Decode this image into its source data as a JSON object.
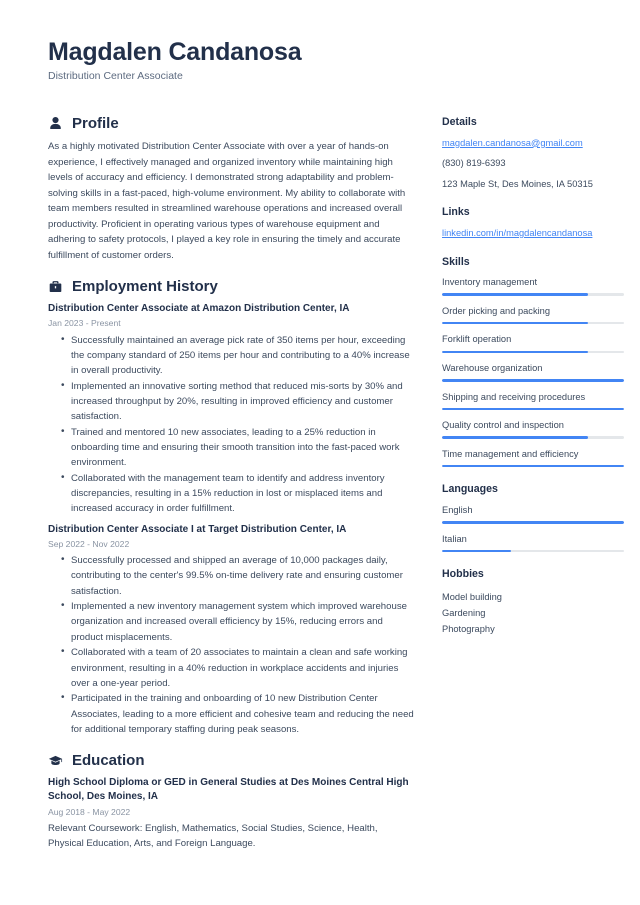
{
  "accent_color": "#4285f4",
  "heading_color": "#22304a",
  "header": {
    "name": "Magdalen Candanosa",
    "job_title": "Distribution Center Associate"
  },
  "profile": {
    "heading": "Profile",
    "icon": "user-icon",
    "text": "As a highly motivated Distribution Center Associate with over a year of hands-on experience, I effectively managed and organized inventory while maintaining high levels of accuracy and efficiency. I demonstrated strong adaptability and problem-solving skills in a fast-paced, high-volume environment. My ability to collaborate with team members resulted in streamlined warehouse operations and increased overall productivity. Proficient in operating various types of warehouse equipment and adhering to safety protocols, I played a key role in ensuring the timely and accurate fulfillment of customer orders."
  },
  "employment": {
    "heading": "Employment History",
    "icon": "briefcase-icon",
    "jobs": [
      {
        "title": "Distribution Center Associate at Amazon Distribution Center, IA",
        "date": "Jan 2023 - Present",
        "bullets": [
          "Successfully maintained an average pick rate of 350 items per hour, exceeding the company standard of 250 items per hour and contributing to a 40% increase in overall productivity.",
          "Implemented an innovative sorting method that reduced mis-sorts by 30% and increased throughput by 20%, resulting in improved efficiency and customer satisfaction.",
          "Trained and mentored 10 new associates, leading to a 25% reduction in onboarding time and ensuring their smooth transition into the fast-paced work environment.",
          "Collaborated with the management team to identify and address inventory discrepancies, resulting in a 15% reduction in lost or misplaced items and increased accuracy in order fulfillment."
        ]
      },
      {
        "title": "Distribution Center Associate I at Target Distribution Center, IA",
        "date": "Sep 2022 - Nov 2022",
        "bullets": [
          "Successfully processed and shipped an average of 10,000 packages daily, contributing to the center's 99.5% on-time delivery rate and ensuring customer satisfaction.",
          "Implemented a new inventory management system which improved warehouse organization and increased overall efficiency by 15%, reducing errors and product misplacements.",
          "Collaborated with a team of 20 associates to maintain a clean and safe working environment, resulting in a 40% reduction in workplace accidents and injuries over a one-year period.",
          "Participated in the training and onboarding of 10 new Distribution Center Associates, leading to a more efficient and cohesive team and reducing the need for additional temporary staffing during peak seasons."
        ]
      }
    ]
  },
  "education": {
    "heading": "Education",
    "icon": "graduation-cap-icon",
    "entries": [
      {
        "title": "High School Diploma or GED in General Studies at Des Moines Central High School, Des Moines, IA",
        "date": "Aug 2018 - May 2022",
        "description": "Relevant Coursework: English, Mathematics, Social Studies, Science, Health, Physical Education, Arts, and Foreign Language."
      }
    ]
  },
  "details": {
    "heading": "Details",
    "email": "magdalen.candanosa@gmail.com",
    "phone": "(830) 819-6393",
    "address": "123 Maple St, Des Moines, IA 50315"
  },
  "links": {
    "heading": "Links",
    "items": [
      {
        "label": "linkedin.com/in/magdalencandanosa"
      }
    ]
  },
  "skills": {
    "heading": "Skills",
    "items": [
      {
        "label": "Inventory management",
        "level": 80
      },
      {
        "label": "Order picking and packing",
        "level": 80
      },
      {
        "label": "Forklift operation",
        "level": 80
      },
      {
        "label": "Warehouse organization",
        "level": 100
      },
      {
        "label": "Shipping and receiving procedures",
        "level": 100
      },
      {
        "label": "Quality control and inspection",
        "level": 80
      },
      {
        "label": "Time management and efficiency",
        "level": 100
      }
    ]
  },
  "languages": {
    "heading": "Languages",
    "items": [
      {
        "label": "English",
        "level": 100
      },
      {
        "label": "Italian",
        "level": 38
      }
    ]
  },
  "hobbies": {
    "heading": "Hobbies",
    "items": [
      {
        "label": "Model building"
      },
      {
        "label": "Gardening"
      },
      {
        "label": "Photography"
      }
    ]
  }
}
